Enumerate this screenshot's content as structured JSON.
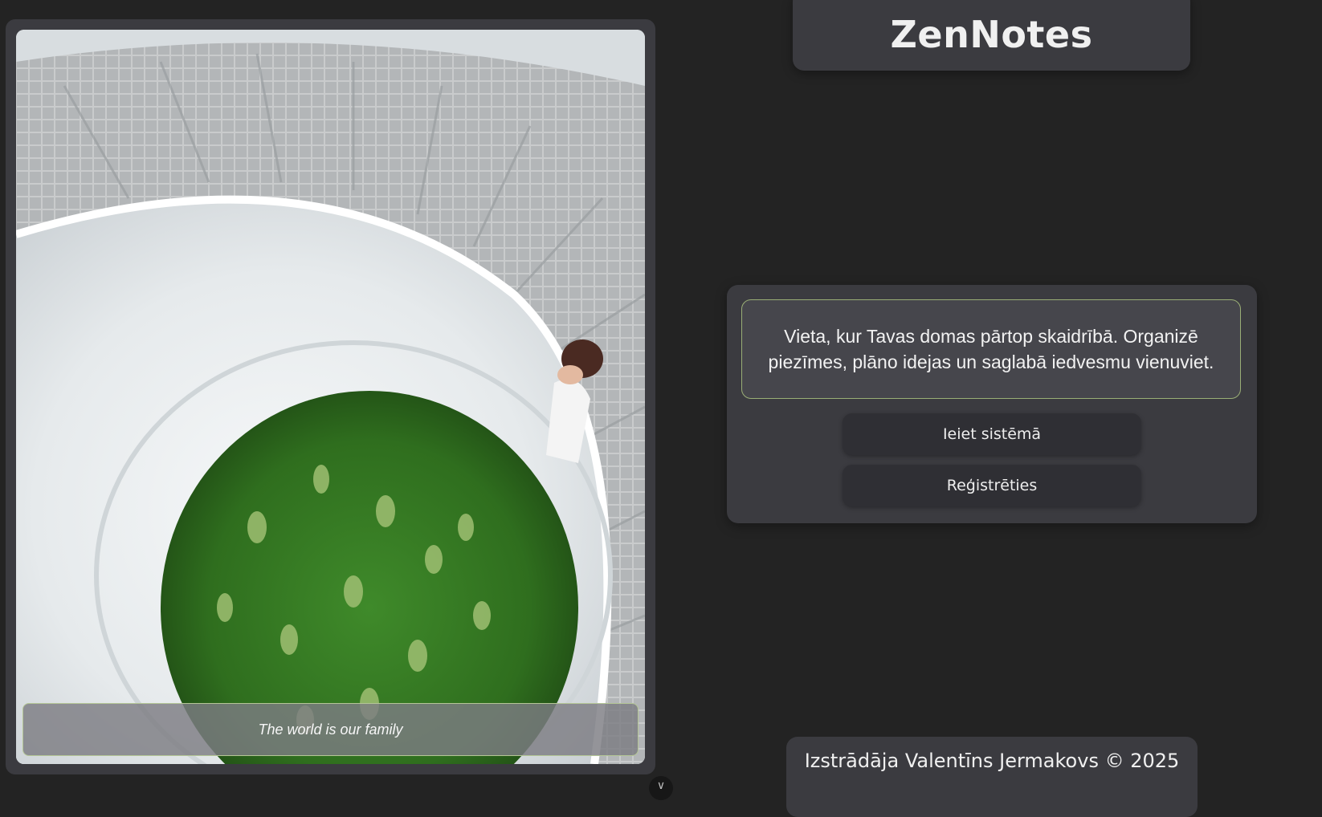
{
  "app": {
    "title": "ZenNotes"
  },
  "hero": {
    "caption": "The world is our family",
    "image_alt": "Aerial view of a white spiral staircase with tiled steps wrapping around a central well filled with green plants; a woman standing on the stairs covering her face"
  },
  "panel": {
    "tagline": "Vieta, kur Tavas domas pārtop skaidrībā. Organizē piezīmes, plāno idejas un saglabā iedvesmu vienuviet.",
    "login_label": "Ieiet sistēmā",
    "register_label": "Reģistrēties"
  },
  "footer": {
    "text": "Izstrādāja Valentīns Jermakovs © 2025"
  },
  "nav": {
    "scroll_icon": "chevron-down-icon",
    "scroll_glyph": "∨"
  },
  "colors": {
    "page_background": "#232323",
    "card_background": "#3b3b40",
    "button_background": "#2f2f34",
    "accent_border": "#9aae76"
  }
}
